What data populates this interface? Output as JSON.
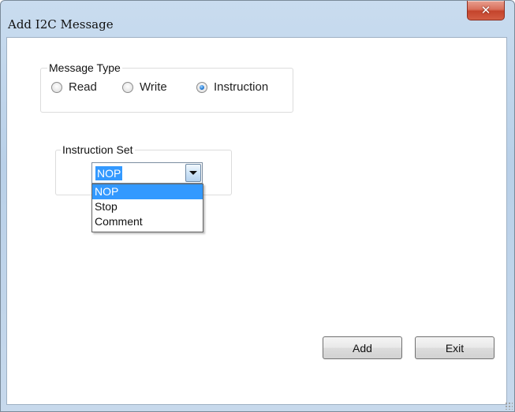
{
  "window": {
    "title": "Add I2C Message",
    "close_label": "✕"
  },
  "message_type": {
    "label": "Message Type",
    "options": [
      {
        "label": "Read",
        "checked": false
      },
      {
        "label": "Write",
        "checked": false
      },
      {
        "label": "Instruction",
        "checked": true
      }
    ]
  },
  "instruction_set": {
    "label": "Instruction Set",
    "selected_value": "NOP",
    "options": [
      "NOP",
      "Stop",
      "Comment"
    ]
  },
  "buttons": {
    "add_label": "Add",
    "exit_label": "Exit"
  },
  "colors": {
    "selection": "#3399ff",
    "close_button": "#c4442c"
  }
}
